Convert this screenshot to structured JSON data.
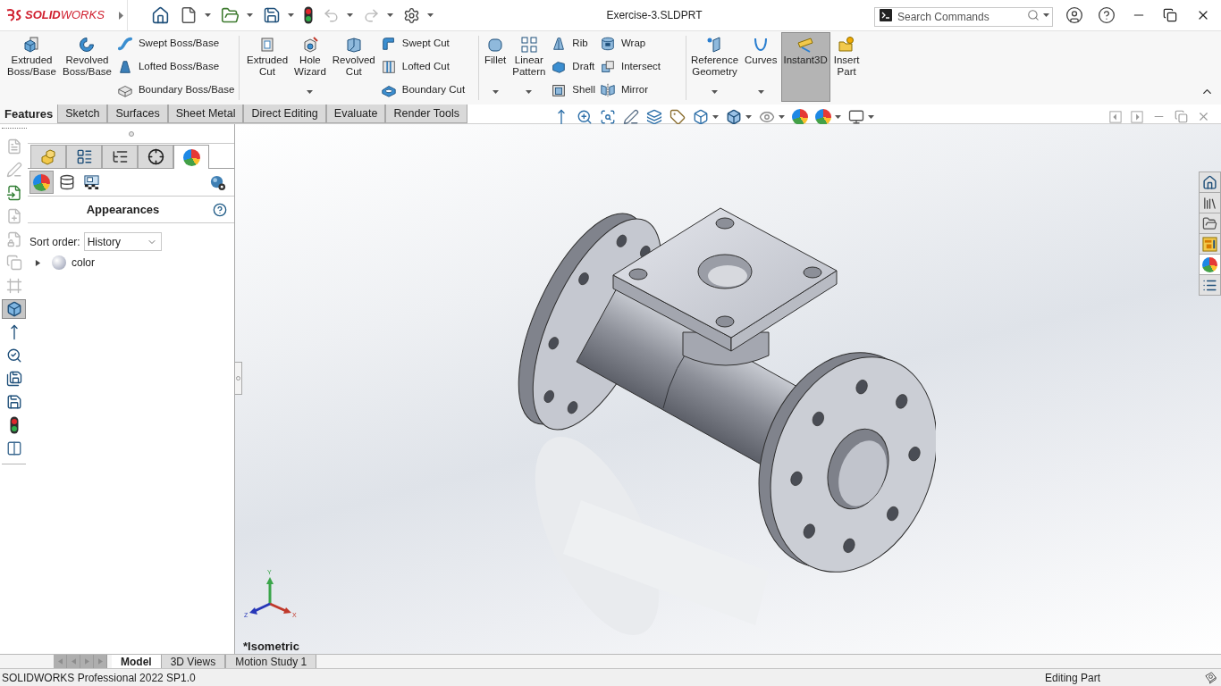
{
  "title_bar": {
    "app_name": "**SOLID**WORKS",
    "quick_access": [
      {
        "menu": false,
        "disabled": false
      },
      {
        "menu": true,
        "disabled": false
      },
      {
        "menu": true,
        "disabled": false
      },
      {
        "menu": true,
        "disabled": false
      },
      {
        "menu": false,
        "disabled": false
      },
      {
        "menu": true,
        "disabled": true
      },
      {
        "menu": true,
        "disabled": true
      },
      {
        "menu": true,
        "disabled": false
      }
    ],
    "document_title": "Exercise-3.SLDPRT",
    "search": {
      "placeholder": "Search Commands"
    }
  },
  "command_manager": {
    "groups": [
      {
        "items": [
          {
            "kind": "large",
            "label": "Extruded Boss/Base",
            "menu": false,
            "on": false
          },
          {
            "kind": "large",
            "label": "Revolved Boss/Base",
            "menu": false,
            "on": false
          },
          {
            "kind": "column",
            "entries": [
              "Swept Boss/Base",
              "Lofted Boss/Base",
              "Boundary Boss/Base"
            ]
          }
        ]
      },
      {
        "items": [
          {
            "kind": "large",
            "label": "Extruded Cut",
            "menu": false,
            "on": false
          },
          {
            "kind": "large",
            "label": "Hole Wizard",
            "menu": true,
            "on": false
          },
          {
            "kind": "large",
            "label": "Revolved Cut",
            "menu": false,
            "on": false
          },
          {
            "kind": "column",
            "entries": [
              "Swept Cut",
              "Lofted Cut",
              "Boundary Cut"
            ]
          }
        ]
      },
      {
        "items": [
          {
            "kind": "large",
            "label": "Fillet",
            "menu": true,
            "on": false
          },
          {
            "kind": "large",
            "label": "Linear Pattern",
            "menu": true,
            "on": false
          },
          {
            "kind": "column",
            "entries": [
              "Rib",
              "Draft",
              "Shell"
            ]
          },
          {
            "kind": "column",
            "entries": [
              "Wrap",
              "Intersect",
              "Mirror"
            ]
          }
        ]
      },
      {
        "items": [
          {
            "kind": "large",
            "label": "Reference Geometry",
            "menu": true,
            "on": false
          },
          {
            "kind": "large",
            "label": "Curves",
            "menu": true,
            "on": false
          },
          {
            "kind": "large",
            "label": "Instant3D",
            "menu": false,
            "on": true
          },
          {
            "kind": "large",
            "label": "Insert Part",
            "menu": false,
            "on": false
          }
        ]
      }
    ],
    "tabs": [
      {
        "label": "Features",
        "selected": true
      },
      {
        "label": "Sketch",
        "selected": false
      },
      {
        "label": "Surfaces",
        "selected": false
      },
      {
        "label": "Sheet Metal",
        "selected": false
      },
      {
        "label": "Direct Editing",
        "selected": false
      },
      {
        "label": "Evaluate",
        "selected": false
      },
      {
        "label": "Render Tools",
        "selected": false
      }
    ]
  },
  "tool_column": [
    {
      "disabled": true,
      "selected": false
    },
    {
      "disabled": true,
      "selected": false
    },
    {
      "disabled": false,
      "selected": false
    },
    {
      "disabled": true,
      "selected": false
    },
    {
      "disabled": true,
      "selected": false
    },
    {
      "disabled": true,
      "selected": false
    },
    {
      "disabled": true,
      "selected": false
    },
    {
      "disabled": false,
      "selected": true
    },
    {
      "disabled": false,
      "selected": false
    },
    {
      "disabled": false,
      "selected": false
    },
    {
      "disabled": false,
      "selected": false
    },
    {
      "disabled": false,
      "selected": false
    },
    {
      "disabled": false,
      "selected": false
    },
    {
      "disabled": false,
      "selected": false
    }
  ],
  "property_panel": {
    "tabs": [
      {
        "selected": false
      },
      {
        "selected": false
      },
      {
        "selected": false
      },
      {
        "selected": false
      },
      {
        "selected": true
      }
    ],
    "filters": [
      {
        "selected": true
      },
      {
        "selected": false
      },
      {
        "selected": false
      }
    ],
    "title": "Appearances",
    "sort": {
      "label": "Sort order:",
      "value": "History"
    },
    "tree": [
      {
        "label": "color",
        "expanded": false
      }
    ]
  },
  "graphics_area": {
    "view_toolbar": [
      {
        "menu": false
      },
      {
        "menu": false
      },
      {
        "menu": false
      },
      {
        "menu": false
      },
      {
        "menu": false
      },
      {
        "menu": false
      },
      {
        "menu": true
      },
      {
        "menu": true
      },
      {
        "menu": true
      },
      {
        "menu": false
      },
      {
        "menu": true
      },
      {
        "menu": true
      }
    ],
    "triad": [
      {
        "label": "Y"
      },
      {
        "label": "X"
      },
      {
        "label": "Z"
      }
    ],
    "view_name": "*Isometric",
    "task_pane": [
      {
        "selected": false
      },
      {
        "selected": false
      },
      {
        "selected": false
      },
      {
        "selected": false
      },
      {
        "selected": true
      },
      {
        "selected": false
      }
    ]
  },
  "bottom_tabs": {
    "scroll_buttons": [
      {
        "disabled": true
      },
      {
        "disabled": true
      },
      {
        "disabled": true
      },
      {
        "disabled": true
      }
    ],
    "tabs": [
      {
        "label": "Model",
        "selected": true
      },
      {
        "label": "3D Views",
        "selected": false
      },
      {
        "label": "Motion Study 1",
        "selected": false
      }
    ]
  },
  "status_bar": {
    "product": "SOLIDWORKS Professional 2022 SP1.0",
    "mode": "Editing Part"
  }
}
